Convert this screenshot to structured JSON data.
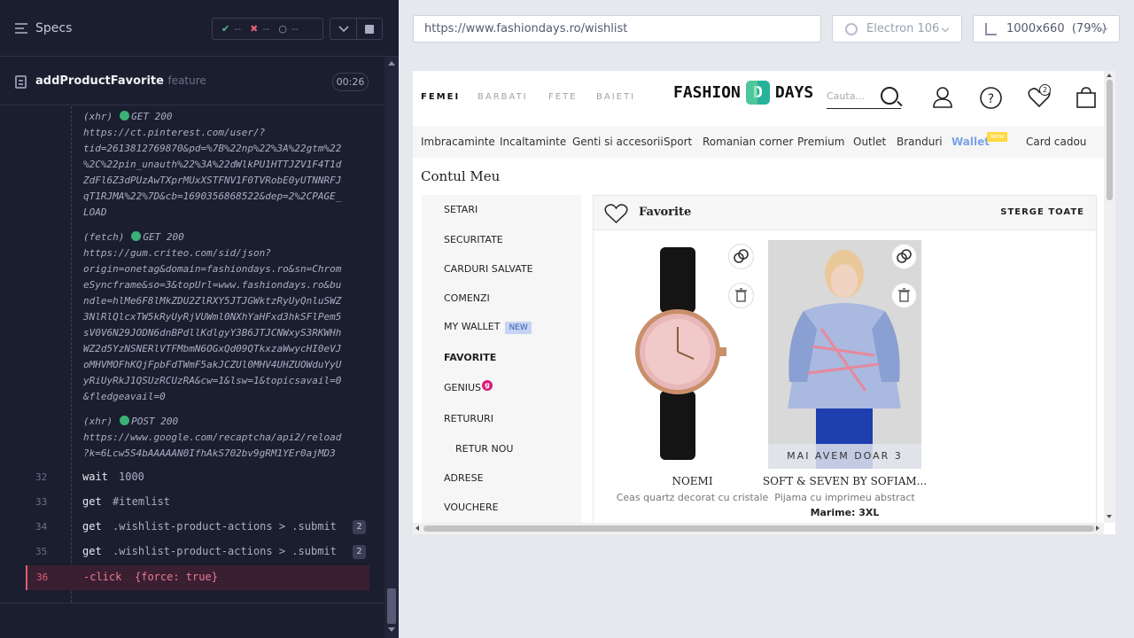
{
  "runner": {
    "specs_label": "Specs",
    "stats": {
      "passed": "--",
      "failed": "--",
      "pending": "--"
    },
    "spec_title": "addProductFavorite",
    "spec_subtitle": "feature",
    "timer": "00:26"
  },
  "log": {
    "requests": [
      {
        "kind": "(xhr)",
        "method": "GET",
        "status": "200",
        "lines": [
          "https://ct.pinterest.com/user/?",
          "tid=2613812769870&pd=%7B%22np%22%3A%22gtm%22",
          "%2C%22pin_unauth%22%3A%22dWlkPU1HTTJZV1F4T1d",
          "ZdFl6Z3dPUzAwTXprMUxXSTFNV1F0TVRobE0yUTNNRFJ",
          "qT1RJMA%22%7D&cb=1690356868522&dep=2%2CPAGE_",
          "LOAD"
        ]
      },
      {
        "kind": "(fetch)",
        "method": "GET",
        "status": "200",
        "lines": [
          "https://gum.criteo.com/sid/json?",
          "origin=onetag&domain=fashiondays.ro&sn=Chrom",
          "eSyncframe&so=3&topUrl=www.fashiondays.ro&bu",
          "ndle=hlMe6F8lMkZDU2ZlRXY5JTJGWktzRyUyQnluSWZ",
          "3NlRlQlcxTW5kRyUyRjVUWml0NXhYaHFxd3hkSFlPem5",
          "sV0V6N29JODN6dnBPdllKdlgyY3B6JTJCNWxyS3RKWHh",
          "WZ2d5YzNSNERlVTFMbmN6OGxQd09QTkxzaWwycHI0eVJ",
          "oMHVMOFhKQjFpbFdTWmF5akJCZUl0MHV4UHZUOWduYyU",
          "yRiUyRkJ1QSUzRCUzRA&cw=1&lsw=1&topicsavail=0",
          "&fledgeavail=0"
        ]
      },
      {
        "kind": "(xhr)",
        "method": "POST",
        "status": "200",
        "lines": [
          "https://www.google.com/recaptcha/api2/reload",
          "?k=6Lcw5S4bAAAAAN0IfhAkS702bv9gRM1YEr0ajMD3"
        ]
      }
    ],
    "commands": [
      {
        "num": "32",
        "name": "wait",
        "arg": "1000",
        "badge": ""
      },
      {
        "num": "33",
        "name": "get",
        "arg": "#itemlist",
        "badge": ""
      },
      {
        "num": "34",
        "name": "get",
        "arg": ".wishlist-product-actions > .submit",
        "badge": "2"
      },
      {
        "num": "35",
        "name": "get",
        "arg": ".wishlist-product-actions > .submit",
        "badge": "2"
      },
      {
        "num": "36",
        "name": "-click",
        "arg": "{force: true}",
        "badge": ""
      }
    ]
  },
  "browser": {
    "url": "https://www.fashiondays.ro/wishlist",
    "browser_name": "Electron 106",
    "viewport": "1000x660",
    "zoom": "(79%)"
  },
  "site": {
    "genders": [
      "FEMEI",
      "BARBATI",
      "FETE",
      "BAIETI"
    ],
    "logo_left": "FASHION",
    "logo_right": "DAYS",
    "search_placeholder": "Cauta...",
    "cart_count": "2",
    "nav": [
      "Imbracaminte",
      "Incaltaminte",
      "Genti si accesorii",
      "Sport",
      "Romanian corner",
      "Premium",
      "Outlet",
      "Branduri",
      "Wallet",
      "Card cadou"
    ],
    "wallet_badge": "New",
    "account_title": "Contul Meu",
    "menu": [
      "SETARI",
      "SECURITATE",
      "CARDURI SALVATE",
      "COMENZI",
      "MY WALLET",
      "FAVORITE",
      "GENIUS",
      "RETURURI",
      "RETUR NOU",
      "ADRESE",
      "VOUCHERE"
    ],
    "menu_new": "NEW",
    "genius_badge": "g",
    "favorites_title": "Favorite",
    "delete_all": "STERGE TOATE",
    "products": [
      {
        "brand": "NOEMI",
        "desc": "Ceas quartz decorat cu cristale",
        "size": ""
      },
      {
        "brand": "SOFT & SEVEN BY SOFIAM...",
        "desc": "Pijama cu imprimeu abstract",
        "size": "Marime: 3XL",
        "stock": "MAI AVEM DOAR 3"
      }
    ],
    "colors": {
      "logo_green": "#27b399",
      "wallet_blue": "#7aa2e6",
      "genius_pink": "#d91b7a"
    }
  }
}
